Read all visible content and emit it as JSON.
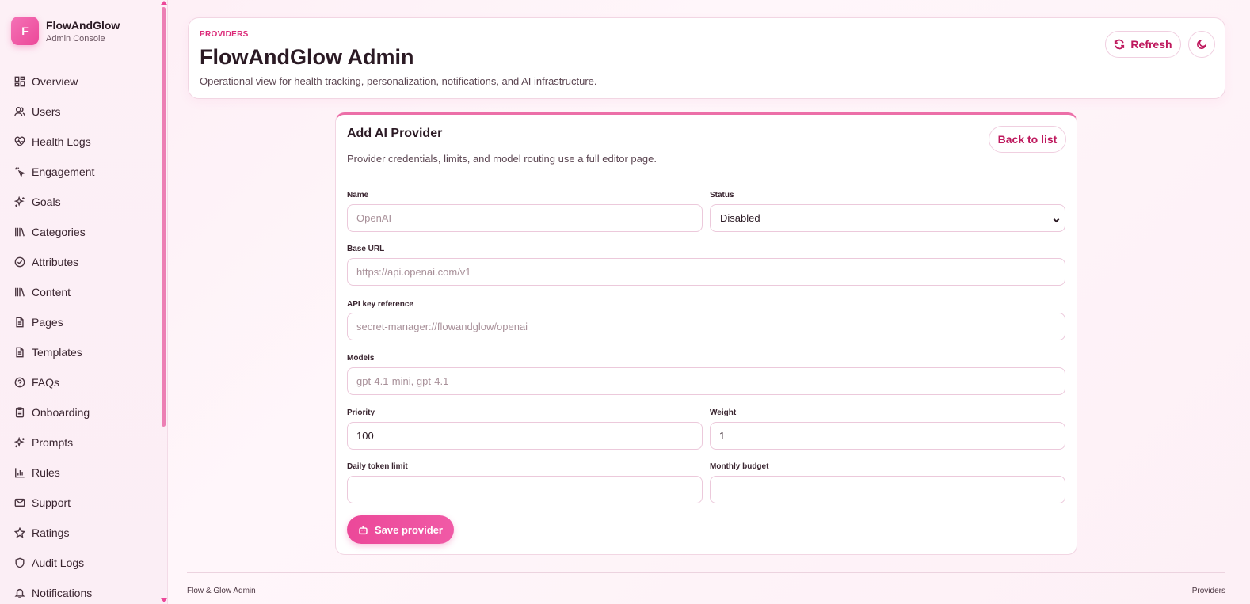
{
  "brand": {
    "logo_letter": "F",
    "name": "FlowAndGlow",
    "subtitle": "Admin Console"
  },
  "sidebar": {
    "items": [
      {
        "label": "Overview",
        "icon": "dashboard-icon"
      },
      {
        "label": "Users",
        "icon": "users-icon"
      },
      {
        "label": "Health Logs",
        "icon": "heart-pulse-icon"
      },
      {
        "label": "Engagement",
        "icon": "sparkle-click-icon"
      },
      {
        "label": "Goals",
        "icon": "sparkles-icon"
      },
      {
        "label": "Categories",
        "icon": "library-icon"
      },
      {
        "label": "Attributes",
        "icon": "check-circle-icon"
      },
      {
        "label": "Content",
        "icon": "library-icon"
      },
      {
        "label": "Pages",
        "icon": "file-text-icon"
      },
      {
        "label": "Templates",
        "icon": "file-text-icon"
      },
      {
        "label": "FAQs",
        "icon": "help-circle-icon"
      },
      {
        "label": "Onboarding",
        "icon": "clipboard-icon"
      },
      {
        "label": "Prompts",
        "icon": "sparkles-icon"
      },
      {
        "label": "Rules",
        "icon": "bar-chart-icon"
      },
      {
        "label": "Support",
        "icon": "mail-icon"
      },
      {
        "label": "Ratings",
        "icon": "star-icon"
      },
      {
        "label": "Audit Logs",
        "icon": "shield-icon"
      },
      {
        "label": "Notifications",
        "icon": "bell-icon"
      }
    ]
  },
  "header": {
    "eyebrow": "PROVIDERS",
    "title": "FlowAndGlow Admin",
    "description": "Operational view for health tracking, personalization, notifications, and AI infrastructure.",
    "refresh_label": "Refresh"
  },
  "form": {
    "title": "Add AI Provider",
    "description": "Provider credentials, limits, and model routing use a full editor page.",
    "back_label": "Back to list",
    "name": {
      "label": "Name",
      "value": "",
      "placeholder": "OpenAI"
    },
    "status": {
      "label": "Status",
      "value": "Disabled"
    },
    "base_url": {
      "label": "Base URL",
      "value": "",
      "placeholder": "https://api.openai.com/v1"
    },
    "api_key": {
      "label": "API key reference",
      "value": "",
      "placeholder": "secret-manager://flowandglow/openai"
    },
    "models": {
      "label": "Models",
      "value": "",
      "placeholder": "gpt-4.1-mini, gpt-4.1"
    },
    "priority": {
      "label": "Priority",
      "value": "100"
    },
    "weight": {
      "label": "Weight",
      "value": "1"
    },
    "daily_limit": {
      "label": "Daily token limit",
      "value": ""
    },
    "monthly_budget": {
      "label": "Monthly budget",
      "value": ""
    },
    "save_label": "Save provider"
  },
  "footer": {
    "left": "Flow & Glow Admin",
    "right": "Providers"
  },
  "colors": {
    "accent": "#ec4899",
    "accent_dark": "#be185d",
    "background": "#fdeef5"
  }
}
